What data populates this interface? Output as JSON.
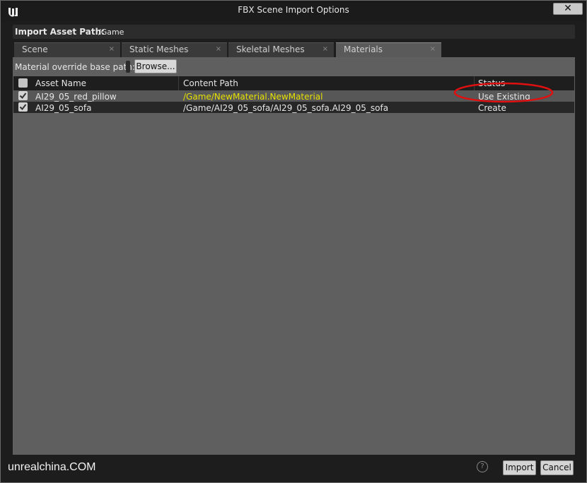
{
  "window": {
    "title": "FBX Scene Import Options",
    "close_glyph": "✕"
  },
  "path_bar": {
    "label": "Import Asset Path:",
    "value": "/Game"
  },
  "tabs": [
    {
      "label": "Scene",
      "close": "×"
    },
    {
      "label": "Static Meshes",
      "close": "×"
    },
    {
      "label": "Skeletal Meshes",
      "close": "×"
    },
    {
      "label": "Materials",
      "close": "×",
      "active": true
    }
  ],
  "materials": {
    "override_label": "Material override base path:",
    "browse_label": "Browse...",
    "columns": {
      "name": "Asset Name",
      "path": "Content Path",
      "status": "Status"
    },
    "rows": [
      {
        "checked": true,
        "name": "AI29_05_red_pillow",
        "path": "/Game/NewMaterial.NewMaterial",
        "status": "Use Existing",
        "path_color": "#e6e000"
      },
      {
        "checked": true,
        "name": "AI29_05_sofa",
        "path": "/Game/AI29_05_sofa/AI29_05_sofa.AI29_05_sofa",
        "status": "Create"
      }
    ]
  },
  "annotation": {
    "shape": "red ellipse around status",
    "color": "#e01010"
  },
  "footer": {
    "watermark": "unrealchina.COM",
    "help_glyph": "?",
    "import_label": "Import",
    "cancel_label": "Cancel"
  }
}
